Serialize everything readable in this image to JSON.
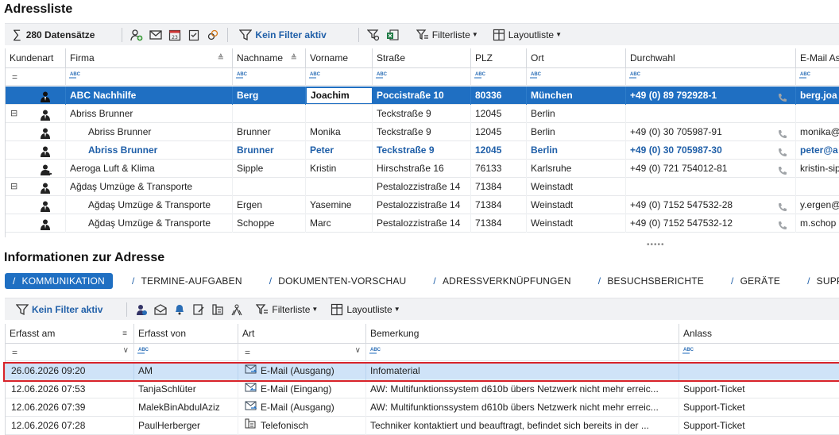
{
  "top_title": "Adressliste",
  "toolbar1": {
    "count_label": "280 Datensätze",
    "filter_label": "Kein Filter aktiv",
    "filterlist_label": "Filterliste",
    "layoutlist_label": "Layoutliste"
  },
  "address_grid": {
    "columns": [
      "Kundenart",
      "Firma",
      "Nachname",
      "Vorname",
      "Straße",
      "PLZ",
      "Ort",
      "Durchwahl",
      "E-Mail Asp"
    ],
    "rows": [
      {
        "firma": "ABC Nachhilfe",
        "nachname": "Berg",
        "vorname": "Joachim",
        "strasse": "Poccistraße 10",
        "plz": "80336",
        "ort": "München",
        "durchwahl": "+49 (0) 89 792928-1",
        "email": "berg.joa"
      },
      {
        "expand": "⊟",
        "firma": "Abriss Brunner",
        "nachname": "",
        "vorname": "",
        "strasse": "Teckstraße 9",
        "plz": "12045",
        "ort": "Berlin",
        "durchwahl": "",
        "email": ""
      },
      {
        "firma": "Abriss Brunner",
        "nachname": "Brunner",
        "vorname": "Monika",
        "strasse": "Teckstraße 9",
        "plz": "12045",
        "ort": "Berlin",
        "durchwahl": "+49 (0) 30 705987-91",
        "email": "monika@"
      },
      {
        "firma": "Abriss Brunner",
        "nachname": "Brunner",
        "vorname": "Peter",
        "strasse": "Teckstraße 9",
        "plz": "12045",
        "ort": "Berlin",
        "durchwahl": "+49 (0) 30 705987-30",
        "email": "peter@a"
      },
      {
        "firma": "Aeroga Luft & Klima",
        "nachname": "Sipple",
        "vorname": "Kristin",
        "strasse": "Hirschstraße 16",
        "plz": "76133",
        "ort": "Karlsruhe",
        "durchwahl": "+49 (0) 721 754012-81",
        "email": "kristin-sip"
      },
      {
        "expand": "⊟",
        "firma": "Ağdaş Umzüge & Transporte",
        "nachname": "",
        "vorname": "",
        "strasse": "Pestalozzistraße 14",
        "plz": "71384",
        "ort": "Weinstadt",
        "durchwahl": "",
        "email": ""
      },
      {
        "firma": "Ağdaş Umzüge & Transporte",
        "nachname": "Ergen",
        "vorname": "Yasemine",
        "strasse": "Pestalozzistraße 14",
        "plz": "71384",
        "ort": "Weinstadt",
        "durchwahl": "+49 (0) 7152 547532-28",
        "email": "y.ergen@"
      },
      {
        "firma": "Ağdaş Umzüge & Transporte",
        "nachname": "Schoppe",
        "vorname": "Marc",
        "strasse": "Pestalozzistraße 14",
        "plz": "71384",
        "ort": "Weinstadt",
        "durchwahl": "+49 (0) 7152 547532-12",
        "email": "m.schop"
      }
    ]
  },
  "info_title": "Informationen zur Adresse",
  "tabs": [
    "KOMMUNIKATION",
    "TERMINE-AUFGABEN",
    "DOKUMENTEN-VORSCHAU",
    "ADRESSVERKNÜPFUNGEN",
    "BESUCHSBERICHTE",
    "GERÄTE",
    "SUPPORT-"
  ],
  "toolbar2": {
    "filter_label": "Kein Filter aktiv",
    "filterlist_label": "Filterliste",
    "layoutlist_label": "Layoutliste"
  },
  "comm_grid": {
    "columns": [
      "Erfasst am",
      "Erfasst von",
      "Art",
      "Bemerkung",
      "Anlass"
    ],
    "rows": [
      {
        "am": "26.06.2026 09:20",
        "von": "AM",
        "art": "E-Mail (Ausgang)",
        "bemerkung": "Infomaterial",
        "anlass": ""
      },
      {
        "am": "12.06.2026 07:53",
        "von": "TanjaSchlüter",
        "art": "E-Mail (Eingang)",
        "bemerkung": "AW: Multifunktionssystem d610b übers Netzwerk nicht mehr erreic...",
        "anlass": "Support-Ticket"
      },
      {
        "am": "12.06.2026 07:39",
        "von": "MalekBinAbdulAziz",
        "art": "E-Mail (Ausgang)",
        "bemerkung": "AW: Multifunktionssystem d610b übers Netzwerk nicht mehr erreic...",
        "anlass": "Support-Ticket"
      },
      {
        "am": "12.06.2026 07:28",
        "von": "PaulHerberger",
        "art": "Telefonisch",
        "bemerkung": "Techniker kontaktiert und beauftragt, befindet sich bereits in der ...",
        "anlass": "Support-Ticket"
      }
    ]
  }
}
